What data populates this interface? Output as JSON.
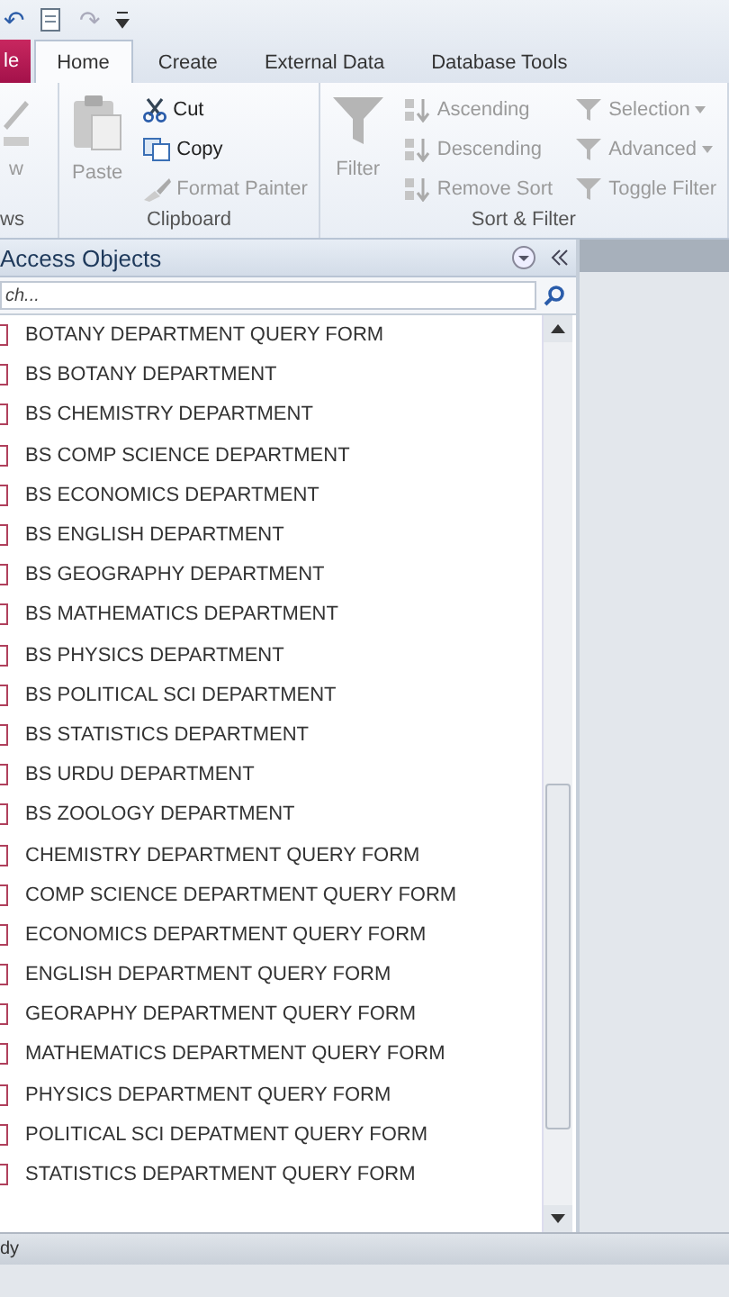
{
  "quick_access": {
    "undo": "↶",
    "redo": "↷"
  },
  "tabs": [
    {
      "label": "le",
      "kind": "file",
      "selected": false
    },
    {
      "label": "Home",
      "kind": "tab",
      "selected": true
    },
    {
      "label": "Create",
      "kind": "tab",
      "selected": false
    },
    {
      "label": "External Data",
      "kind": "tab",
      "selected": false
    },
    {
      "label": "Database Tools",
      "kind": "tab",
      "selected": false
    }
  ],
  "ribbon": {
    "groups": [
      {
        "label": "ws",
        "big": [
          {
            "label": "w",
            "disabled": true
          }
        ]
      },
      {
        "label": "Clipboard",
        "big": [
          {
            "label": "Paste",
            "disabled": true
          }
        ],
        "small": [
          {
            "label": "Cut",
            "disabled": false
          },
          {
            "label": "Copy",
            "disabled": false
          },
          {
            "label": "Format Painter",
            "disabled": true
          }
        ]
      },
      {
        "label": "Sort & Filter",
        "big": [
          {
            "label": "Filter",
            "disabled": true
          }
        ],
        "small": [
          {
            "label": "Ascending",
            "disabled": true
          },
          {
            "label": "Descending",
            "disabled": true
          },
          {
            "label": "Remove Sort",
            "disabled": true
          },
          {
            "label": "Selection",
            "disabled": true,
            "dropdown": true
          },
          {
            "label": "Advanced",
            "disabled": true,
            "dropdown": true
          },
          {
            "label": "Toggle Filter",
            "disabled": true,
            "dropdown": false
          }
        ]
      }
    ]
  },
  "nav_pane": {
    "title": "Access Objects",
    "search": {
      "placeholder": "ch..."
    },
    "items": [
      {
        "label": "BOTANY DEPARTMENT QUERY FORM"
      },
      {
        "label": "BS BOTANY DEPARTMENT"
      },
      {
        "label": "BS CHEMISTRY DEPARTMENT"
      },
      {
        "label": "BS COMP SCIENCE DEPARTMENT"
      },
      {
        "label": "BS ECONOMICS DEPARTMENT"
      },
      {
        "label": "BS ENGLISH DEPARTMENT"
      },
      {
        "label": "BS GEOGRAPHY DEPARTMENT"
      },
      {
        "label": "BS MATHEMATICS DEPARTMENT"
      },
      {
        "label": "BS PHYSICS DEPARTMENT"
      },
      {
        "label": "BS POLITICAL SCI DEPARTMENT"
      },
      {
        "label": "BS STATISTICS DEPARTMENT"
      },
      {
        "label": "BS URDU DEPARTMENT"
      },
      {
        "label": "BS ZOOLOGY DEPARTMENT"
      },
      {
        "label": "CHEMISTRY DEPARTMENT QUERY FORM"
      },
      {
        "label": "COMP SCIENCE DEPARTMENT QUERY FORM"
      },
      {
        "label": "ECONOMICS DEPARTMENT QUERY FORM"
      },
      {
        "label": "ENGLISH DEPARTMENT QUERY FORM"
      },
      {
        "label": "GEORAPHY DEPARTMENT QUERY FORM"
      },
      {
        "label": "MATHEMATICS DEPARTMENT QUERY FORM"
      },
      {
        "label": "PHYSICS DEPARTMENT QUERY FORM"
      },
      {
        "label": "POLITICAL SCI DEPATMENT QUERY FORM"
      },
      {
        "label": "STATISTICS DEPARTMENT QUERY FORM"
      }
    ]
  },
  "status_bar": {
    "text": "dy"
  }
}
